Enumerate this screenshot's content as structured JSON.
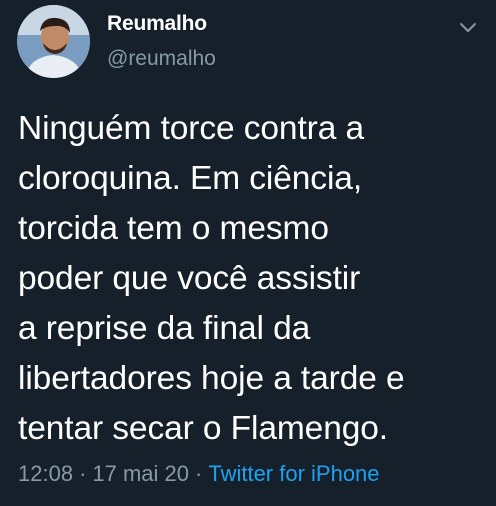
{
  "author": {
    "display_name": "Reumalho",
    "handle": "@reumalho"
  },
  "tweet": {
    "text": "Ninguém torce contra a\ncloroquina. Em ciência,\ntorcida tem o mesmo\npoder que você assistir\na reprise da final da\nlibertadores hoje a tarde e\ntentar secar o Flamengo."
  },
  "meta": {
    "time": "12:08",
    "separator": "·",
    "date": "17 mai 20",
    "source": "Twitter for iPhone"
  },
  "icons": {
    "menu": "chevron-down-icon",
    "avatar": "profile-photo"
  },
  "colors": {
    "background": "#15202b",
    "secondary_text": "#8899a6",
    "link": "#1da1f2"
  }
}
